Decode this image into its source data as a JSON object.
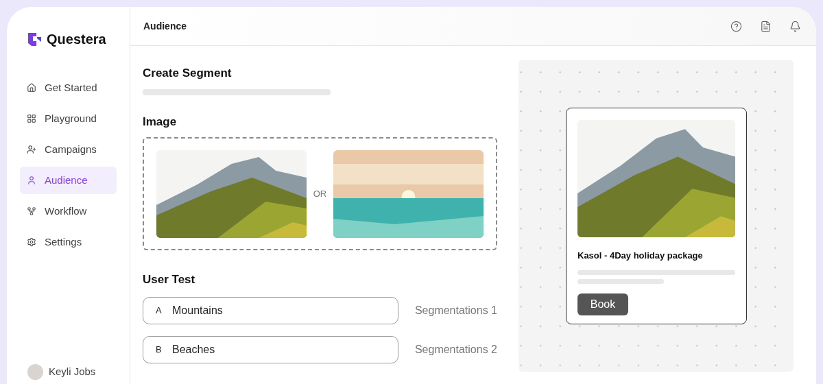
{
  "app": {
    "name": "Questera"
  },
  "sidebar": {
    "items": [
      {
        "label": "Get Started",
        "selected": false
      },
      {
        "label": "Playground",
        "selected": false
      },
      {
        "label": "Campaigns",
        "selected": false
      },
      {
        "label": "Audience",
        "selected": true
      },
      {
        "label": "Workflow",
        "selected": false
      },
      {
        "label": "Settings",
        "selected": false
      }
    ]
  },
  "user": {
    "name": "Keyli Jobs"
  },
  "header": {
    "title": "Audience"
  },
  "segment": {
    "title": "Create Segment",
    "image_section": {
      "title": "Image",
      "separator": "OR"
    },
    "user_test": {
      "title": "User Test",
      "variants": [
        {
          "letter": "A",
          "value": "Mountains",
          "segment": "Segmentations 1"
        },
        {
          "letter": "B",
          "value": "Beaches",
          "segment": "Segmentations 2"
        }
      ]
    }
  },
  "preview": {
    "card": {
      "title": "Kasol - 4Day holiday package",
      "button": "Book"
    }
  }
}
